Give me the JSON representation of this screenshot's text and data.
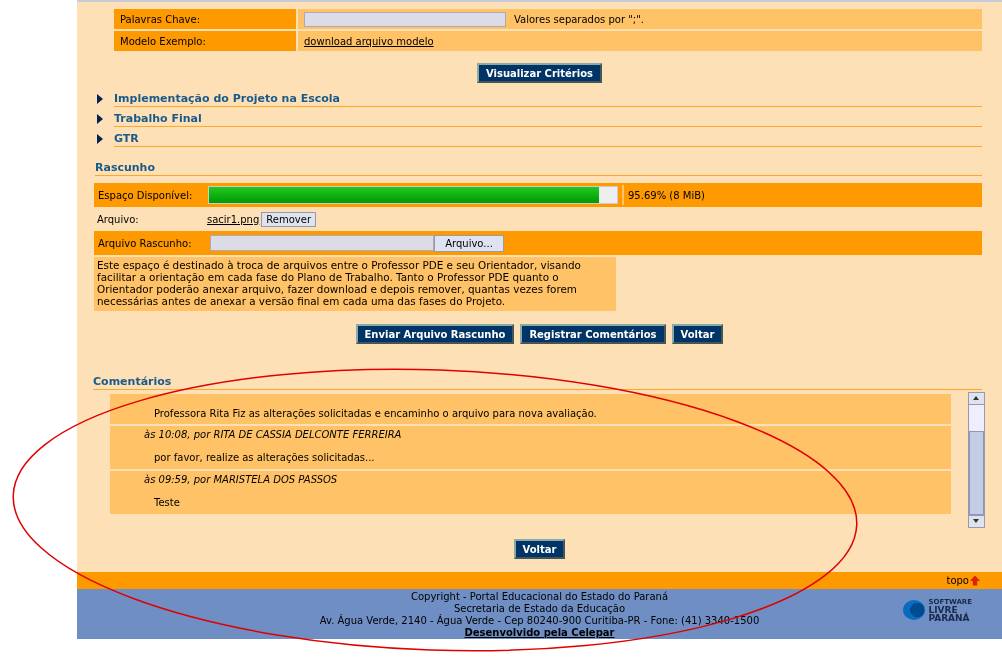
{
  "form_rows": [
    {
      "label": "Palavras Chave:",
      "kind": "input",
      "hint": "Valores separados por \";\"."
    },
    {
      "label": "Modelo Exemplo:",
      "kind": "link",
      "link": "download arquivo modelo"
    }
  ],
  "criteria_button": "Visualizar Critérios",
  "sections": [
    {
      "title": "Implementação do Projeto na Escola",
      "expanded": false
    },
    {
      "title": "Trabalho Final",
      "expanded": false
    },
    {
      "title": "GTR",
      "expanded": false
    }
  ],
  "draft": {
    "title": "Rascunho",
    "space_label": "Espaço Disponível:",
    "level": 0.9569,
    "space_reading": "95.69% (8 MiB)",
    "file_label": "Arquivo:",
    "file_name": "sacir1.png",
    "remove_button": "Remover",
    "upload_label": "Arquivo Rascunho:",
    "browse_button": "Arquivo...",
    "description": "Este espaço é destinado à troca de arquivos entre o Professor PDE e seu Orientador, visando facilitar a orientação em cada fase do Plano de Trabalho. Tanto o Professor PDE quanto o Orientador poderão anexar arquivo, fazer download e depois remover, quantas vezes forem necessárias antes de anexar a versão final em cada uma das fases do Projeto.",
    "buttons": [
      "Enviar Arquivo Rascunho",
      "Registrar Comentários",
      "Voltar"
    ]
  },
  "comments": {
    "title": "Comentários",
    "items": [
      {
        "text": "Professora Rita Fiz as alterações solicitadas e encaminho o arquivo para nova avaliação."
      },
      {
        "header": "às 10:08, por RITA DE CASSIA DELCONTE FERREIRA",
        "text": "por favor, realize as alterações solicitadas..."
      },
      {
        "header": "às 09:59, por MARISTELA DOS PASSOS",
        "text": "Teste"
      }
    ],
    "back_button": "Voltar"
  },
  "top_link": "topo",
  "footer": {
    "lines": [
      "Copyright - Portal Educacional do Estado do Paraná",
      "Secretaria de Estado da Educação",
      "Av. Água Verde, 2140 - Água Verde - Cep 80240-900 Curitiba-PR - Fone: (41) 3340-1500"
    ],
    "credit": "Desenvolvido pela Celepar",
    "logo": [
      "SOFTWARE",
      "LIVRE",
      "PARANÁ"
    ]
  }
}
